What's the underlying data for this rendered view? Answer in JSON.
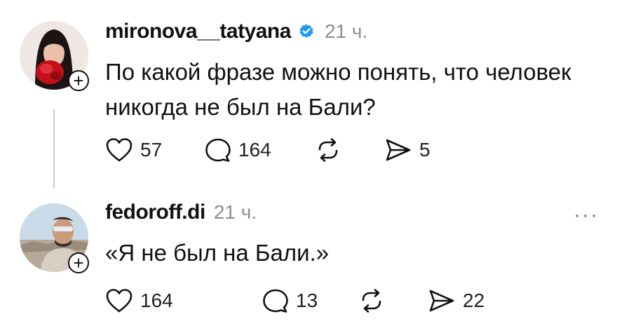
{
  "posts": [
    {
      "username": "mironova__tatyana",
      "verified": true,
      "time": "21 ч.",
      "text_line1": "По какой фразе можно понять, что человек",
      "text_line2": "никогда не был на Бали?",
      "likes": "57",
      "replies": "164",
      "shares": "5"
    },
    {
      "username": "fedoroff.di",
      "verified": false,
      "time": "21 ч.",
      "text_line1": "«Я не был на Бали.»",
      "likes": "164",
      "replies": "13",
      "shares": "22"
    }
  ],
  "icons": {
    "follow": "+",
    "more": "···"
  },
  "colors": {
    "verified_badge": "#1d9bf0",
    "secondary_text": "#8e8e8e",
    "thread_line": "#c9c9c9"
  }
}
